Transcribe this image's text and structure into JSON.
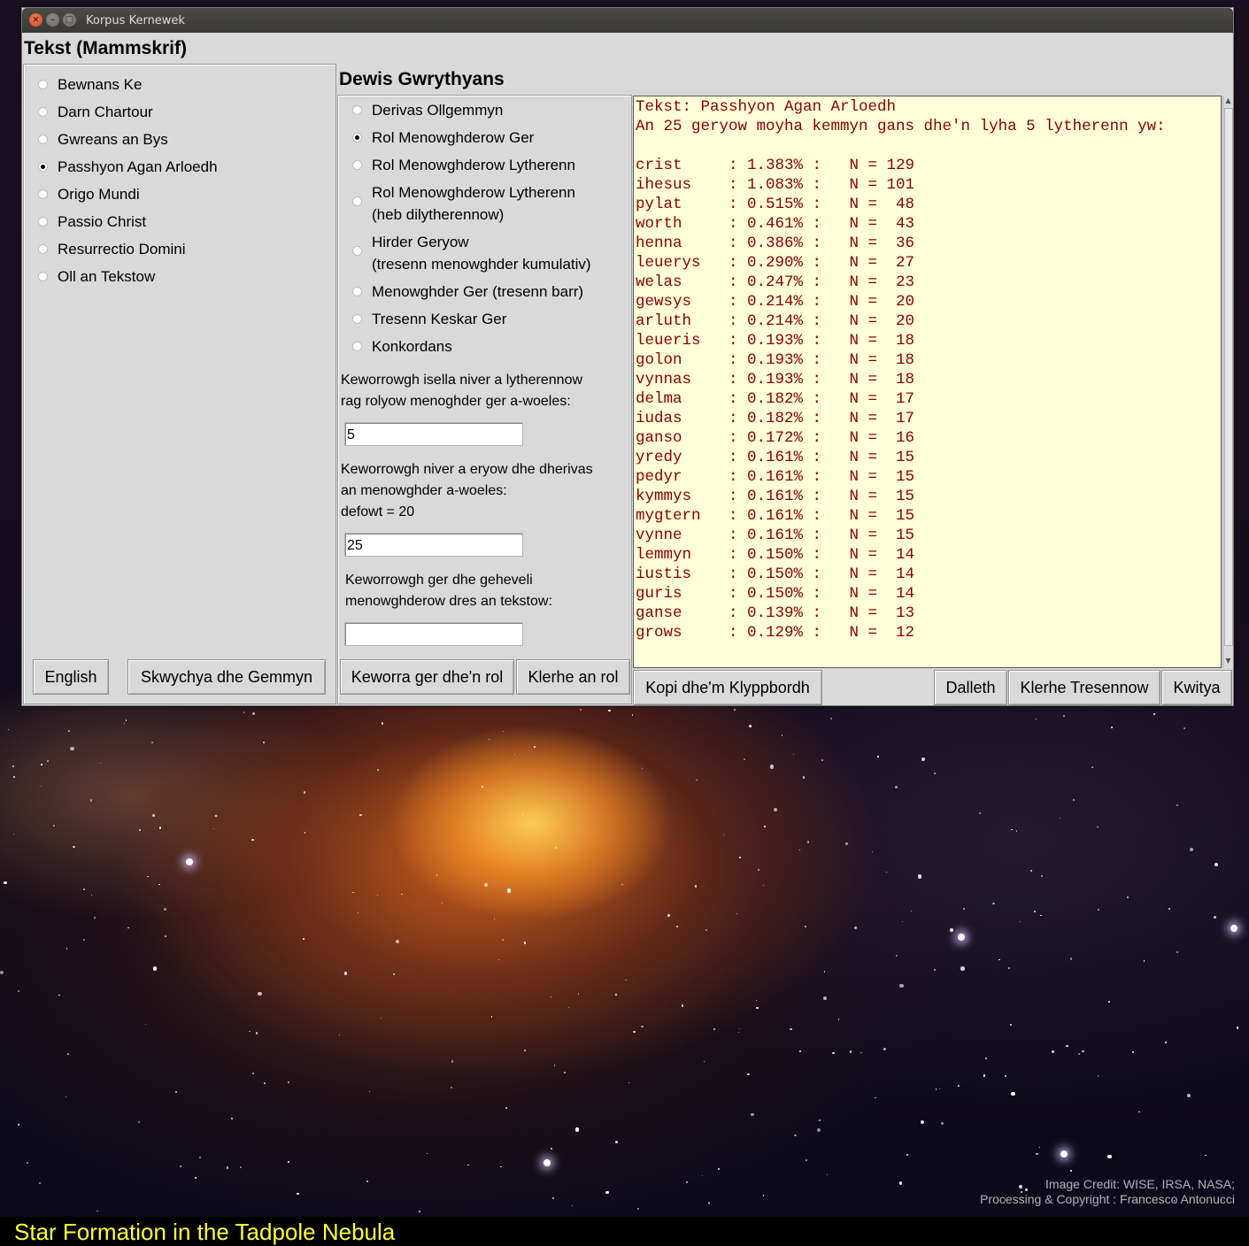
{
  "window": {
    "title": "Korpus Kernewek",
    "controls": [
      "close-icon",
      "minimize-icon",
      "maximize-icon"
    ]
  },
  "text_panel": {
    "heading": "Tekst (Mammskrif)",
    "options": [
      {
        "label": "Bewnans Ke",
        "selected": false
      },
      {
        "label": "Darn Chartour",
        "selected": false
      },
      {
        "label": "Gwreans an Bys",
        "selected": false
      },
      {
        "label": "Passhyon Agan Arloedh",
        "selected": true
      },
      {
        "label": "Origo Mundi",
        "selected": false
      },
      {
        "label": "Passio Christ",
        "selected": false
      },
      {
        "label": "Resurrectio Domini",
        "selected": false
      },
      {
        "label": "Oll an Tekstow",
        "selected": false
      }
    ],
    "english_button": "English",
    "clear_selection_button": "Skwychya dhe Gemmyn"
  },
  "function_panel": {
    "heading": "Dewis Gwrythyans",
    "options": [
      {
        "label": "Derivas Ollgemmyn",
        "selected": false
      },
      {
        "label": "Rol Menowghderow Ger",
        "selected": true
      },
      {
        "label": "Rol Menowghderow Lytherenn",
        "selected": false
      },
      {
        "label": "Rol Menowghderow Lytherenn",
        "label2": "(heb dilytherennow)",
        "selected": false
      },
      {
        "label": "Hirder Geryow",
        "label2": "(tresenn menowghder kumulativ)",
        "selected": false
      },
      {
        "label": "Menowghder Ger (tresenn barr)",
        "selected": false
      },
      {
        "label": "Tresenn Keskar Ger",
        "selected": false
      },
      {
        "label": "Konkordans",
        "selected": false
      }
    ],
    "min_letters_prompt_1": "Keworrowgh isella niver a lytherennow",
    "min_letters_prompt_2": "rag rolyow menoghder ger a-woeles:",
    "min_letters_value": "5",
    "num_words_prompt_1": "Keworrowgh niver a eryow dhe dherivas",
    "num_words_prompt_2": "an menowghder a-woeles:",
    "num_words_prompt_3": "defowt = 20",
    "num_words_value": "25",
    "compare_prompt_1": "Keworrowgh ger dhe geheveli",
    "compare_prompt_2": "menowghderow dres an tekstow:",
    "compare_value": "",
    "add_word_button": "Keworra ger dhe'n rol",
    "clear_list_button": "Klerhe an rol"
  },
  "output": {
    "title_line": "Tekst: Passhyon Agan Arloedh",
    "summary_line": "An 25 geryow moyha kemmyn gans dhe'n lyha 5 lytherenn yw:",
    "rows": [
      {
        "word": "crist",
        "pct": "1.383%",
        "n": "129"
      },
      {
        "word": "ihesus",
        "pct": "1.083%",
        "n": "101"
      },
      {
        "word": "pylat",
        "pct": "0.515%",
        "n": "48"
      },
      {
        "word": "worth",
        "pct": "0.461%",
        "n": "43"
      },
      {
        "word": "henna",
        "pct": "0.386%",
        "n": "36"
      },
      {
        "word": "leuerys",
        "pct": "0.290%",
        "n": "27"
      },
      {
        "word": "welas",
        "pct": "0.247%",
        "n": "23"
      },
      {
        "word": "gewsys",
        "pct": "0.214%",
        "n": "20"
      },
      {
        "word": "arluth",
        "pct": "0.214%",
        "n": "20"
      },
      {
        "word": "leueris",
        "pct": "0.193%",
        "n": "18"
      },
      {
        "word": "golon",
        "pct": "0.193%",
        "n": "18"
      },
      {
        "word": "vynnas",
        "pct": "0.193%",
        "n": "18"
      },
      {
        "word": "delma",
        "pct": "0.182%",
        "n": "17"
      },
      {
        "word": "iudas",
        "pct": "0.182%",
        "n": "17"
      },
      {
        "word": "ganso",
        "pct": "0.172%",
        "n": "16"
      },
      {
        "word": "yredy",
        "pct": "0.161%",
        "n": "15"
      },
      {
        "word": "pedyr",
        "pct": "0.161%",
        "n": "15"
      },
      {
        "word": "kymmys",
        "pct": "0.161%",
        "n": "15"
      },
      {
        "word": "mygtern",
        "pct": "0.161%",
        "n": "15"
      },
      {
        "word": "vynne",
        "pct": "0.161%",
        "n": "15"
      },
      {
        "word": "lemmyn",
        "pct": "0.150%",
        "n": "14"
      },
      {
        "word": "iustis",
        "pct": "0.150%",
        "n": "14"
      },
      {
        "word": "guris",
        "pct": "0.150%",
        "n": "14"
      },
      {
        "word": "ganse",
        "pct": "0.139%",
        "n": "13"
      },
      {
        "word": "grows",
        "pct": "0.129%",
        "n": "12"
      }
    ],
    "text_color": "#8b0000",
    "background_color": "#ffffd9"
  },
  "bottom_buttons": {
    "copy": "Kopi dhe'm Klyppbordh",
    "start": "Dalleth",
    "clear_plots": "Klerhe Tresennow",
    "quit": "Kwitya"
  },
  "desktop": {
    "caption": "Star Formation in the Tadpole Nebula",
    "caption_color": "#ffff33",
    "credit_line_1": "Image Credit: WISE, IRSA, NASA;",
    "credit_line_2": "Processing & Copyright : Francesco Antonucci"
  }
}
